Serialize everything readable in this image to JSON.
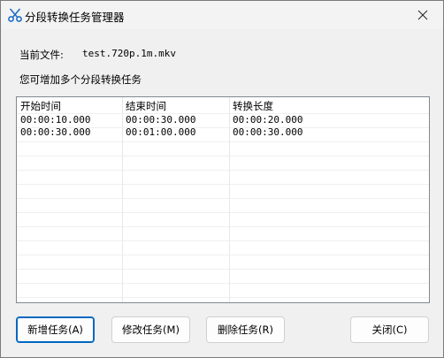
{
  "window": {
    "title": "分段转换任务管理器",
    "title_icon": "scissors-icon",
    "close_icon": "close-icon"
  },
  "file": {
    "label": "当前文件:",
    "value": "test.720p.1m.mkv"
  },
  "hint": "您可增加多个分段转换任务",
  "table": {
    "columns": [
      "开始时间",
      "结束时间",
      "转换长度"
    ],
    "rows": [
      [
        "00:00:10.000",
        "00:00:30.000",
        "00:00:20.000"
      ],
      [
        "00:00:30.000",
        "00:01:00.000",
        "00:00:30.000"
      ]
    ]
  },
  "buttons": {
    "add": "新增任务(A)",
    "edit": "修改任务(M)",
    "delete": "删除任务(R)",
    "close": "关闭(C)"
  },
  "colors": {
    "accent": "#0067c0",
    "window_bg": "#f0f0f0",
    "titlebar_bg": "#f3f3f3",
    "scissors_blue": "#1f6fc5"
  }
}
